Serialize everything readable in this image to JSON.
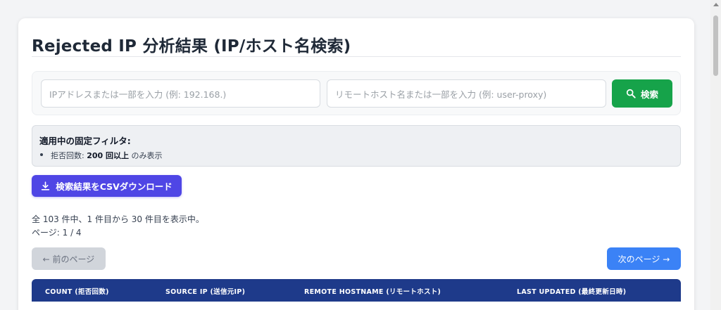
{
  "page": {
    "title": "Rejected IP 分析結果 (IP/ホスト名検索)"
  },
  "search": {
    "ip_placeholder": "IPアドレスまたは一部を入力 (例: 192.168.)",
    "host_placeholder": "リモートホスト名または一部を入力 (例: user-proxy)",
    "button_label": "検索"
  },
  "filter": {
    "title": "適用中の固定フィルタ:",
    "item_prefix": "拒否回数: ",
    "item_value": "200 回以上",
    "item_suffix": " のみ表示"
  },
  "csv_button_label": "検索結果をCSVダウンロード",
  "summary": {
    "line1": "全 103 件中、1 件目から 30 件目を表示中。",
    "line2": "ページ: 1 / 4"
  },
  "pagination": {
    "prev_label": "← 前のページ",
    "next_label": "次のページ →"
  },
  "table": {
    "columns": [
      "COUNT (拒否回数)",
      "SOURCE IP (送信元IP)",
      "REMOTE HOSTNAME (リモートホスト)",
      "LAST UPDATED (最終更新日時)"
    ]
  },
  "colors": {
    "search_button": "#16a34a",
    "csv_button": "#4f46e5",
    "next_button": "#3b82f6",
    "table_header": "#1e3a8a"
  }
}
